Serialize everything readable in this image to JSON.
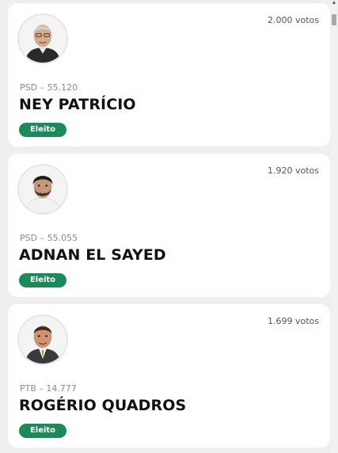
{
  "candidates": [
    {
      "votes": "2.000 votos",
      "party": "PSD – 55.120",
      "name": "NEY PATRÍCIO",
      "status": "Eleito",
      "avatar_icon": "candidate-photo-icon",
      "colors": {
        "suit": "#2a2a2a",
        "skin": "#d9a98a",
        "hair": "#cfcfcf"
      }
    },
    {
      "votes": "1.920 votos",
      "party": "PSD – 55.055",
      "name": "ADNAN EL SAYED",
      "status": "Eleito",
      "avatar_icon": "candidate-photo-icon",
      "colors": {
        "suit": "#f2f2f2",
        "skin": "#c99679",
        "hair": "#1c1c1c"
      }
    },
    {
      "votes": "1.699 votos",
      "party": "PTB – 14.777",
      "name": "ROGÉRIO QUADROS",
      "status": "Eleito",
      "avatar_icon": "candidate-photo-icon",
      "colors": {
        "suit": "#3a3a3a",
        "skin": "#d3926e",
        "hair": "#3b2a1e"
      }
    }
  ],
  "theme": {
    "badge_color": "#1b8a5a"
  }
}
